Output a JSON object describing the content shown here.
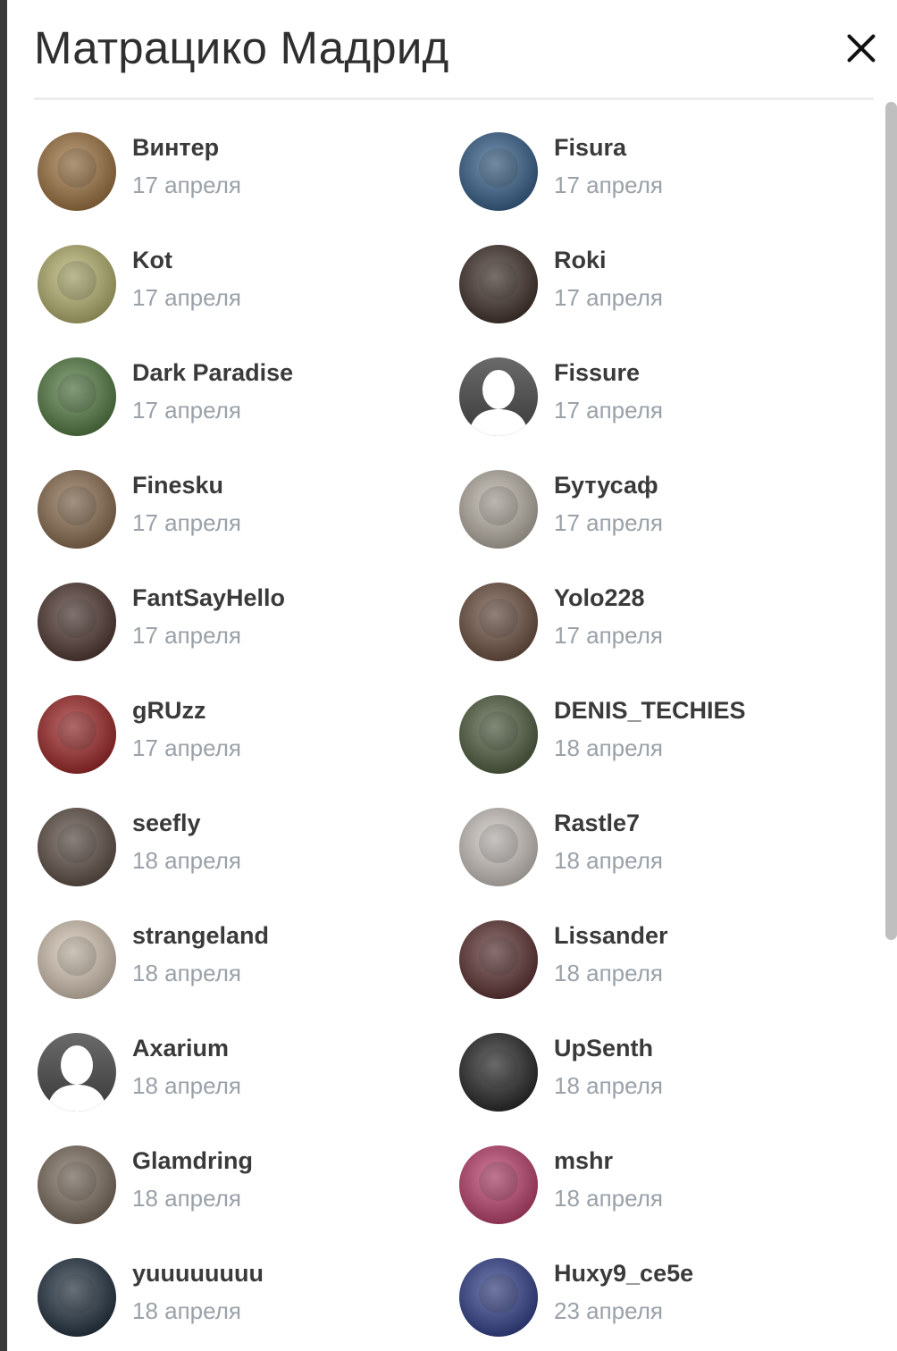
{
  "modal": {
    "title": "Матрацико Мадрид"
  },
  "members": [
    {
      "name": "Винтер",
      "date": "17 апреля",
      "avatar": "lion-avatar",
      "color": "#a0713a"
    },
    {
      "name": "Fisura",
      "date": "17 апреля",
      "avatar": "man-cap-avatar",
      "color": "#2f5d8a"
    },
    {
      "name": "Kot",
      "date": "17 апреля",
      "avatar": "cat-glasses-avatar",
      "color": "#b7b46a"
    },
    {
      "name": "Roki",
      "date": "17 апреля",
      "avatar": "dark-portrait-avatar",
      "color": "#3a2a22"
    },
    {
      "name": "Dark Paradise",
      "date": "17 апреля",
      "avatar": "cat-garden-avatar",
      "color": "#4f7a3c"
    },
    {
      "name": "Fissure",
      "date": "17 апреля",
      "avatar": "default-user-avatar",
      "color": "#5e5e5e"
    },
    {
      "name": "Finesku",
      "date": "17 апреля",
      "avatar": "pilot-cat-avatar",
      "color": "#8a6a4a"
    },
    {
      "name": "Бутусаф",
      "date": "17 апреля",
      "avatar": "white-cat-avatar",
      "color": "#b9b1a4"
    },
    {
      "name": "FantSayHello",
      "date": "17 апреля",
      "avatar": "soldier-avatar",
      "color": "#4a3028"
    },
    {
      "name": "Yolo228",
      "date": "17 апреля",
      "avatar": "bearded-man-avatar",
      "color": "#6a4a3a"
    },
    {
      "name": "gRUzz",
      "date": "17 апреля",
      "avatar": "red-creature-avatar",
      "color": "#a11e1e"
    },
    {
      "name": "DENIS_TECHIES",
      "date": "18 апреля",
      "avatar": "beaver-avatar",
      "color": "#4a5a38"
    },
    {
      "name": "seefly",
      "date": "18 апреля",
      "avatar": "man-suit-avatar",
      "color": "#5a4a40"
    },
    {
      "name": "Rastle7",
      "date": "18 апреля",
      "avatar": "doll-avatar",
      "color": "#cfc8c2"
    },
    {
      "name": "strangeland",
      "date": "18 апреля",
      "avatar": "twins-avatar",
      "color": "#d8c8b4"
    },
    {
      "name": "Lissander",
      "date": "18 апреля",
      "avatar": "bunny-avatar",
      "color": "#5a2a2a"
    },
    {
      "name": "Axarium",
      "date": "18 апреля",
      "avatar": "default-user-avatar",
      "color": "#5e5e5e"
    },
    {
      "name": "UpSenth",
      "date": "18 апреля",
      "avatar": "hooded-figure-avatar",
      "color": "#1e1e1e"
    },
    {
      "name": "Glamdring",
      "date": "18 апреля",
      "avatar": "man-sign-avatar",
      "color": "#7a6a5a"
    },
    {
      "name": "mshr",
      "date": "18 апреля",
      "avatar": "neon-girl-avatar",
      "color": "#c0396a"
    },
    {
      "name": "yuuuuuuuu",
      "date": "18 апреля",
      "avatar": "night-sky-avatar",
      "color": "#1a2a3a"
    },
    {
      "name": "Huxy9_ce5e",
      "date": "23 апреля",
      "avatar": "young-man-avatar",
      "color": "#2a3a8a"
    }
  ]
}
